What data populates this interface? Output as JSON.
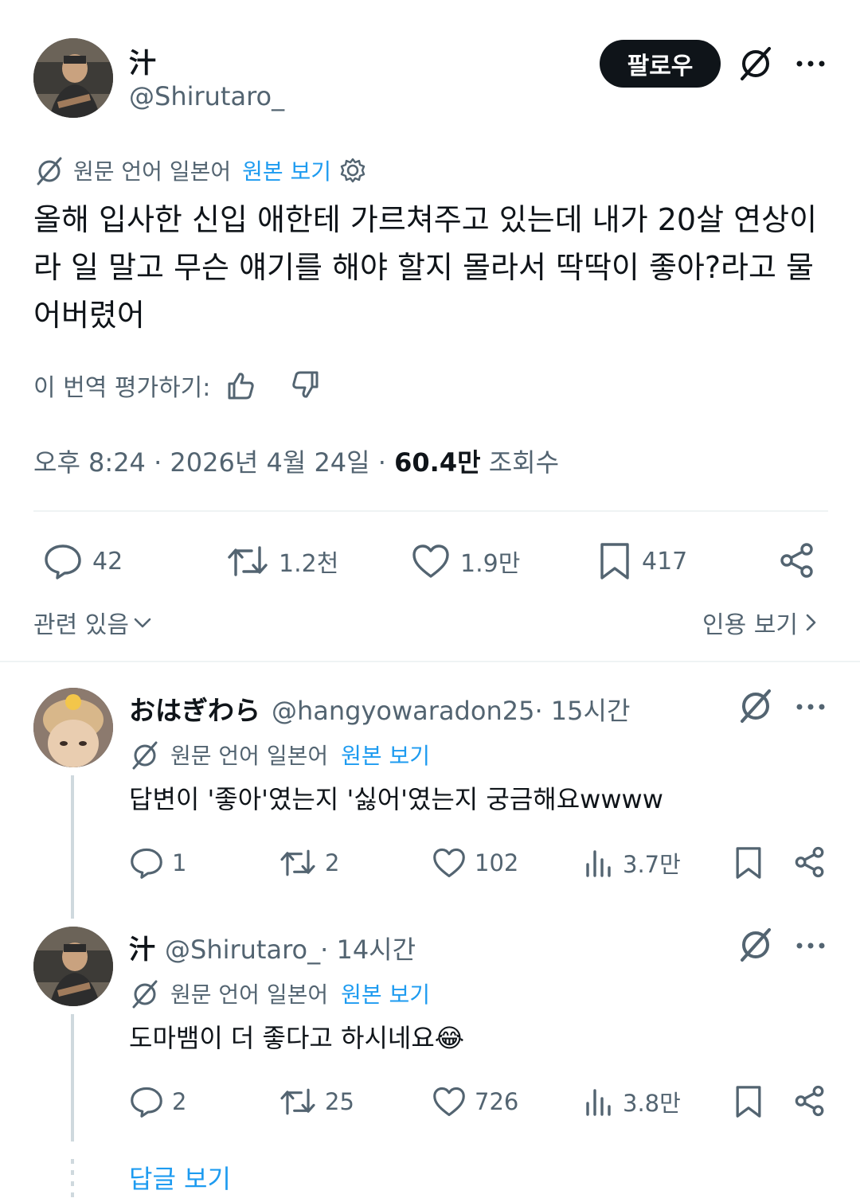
{
  "main_tweet": {
    "display_name": "汁",
    "handle": "@Shirutaro_",
    "follow_label": "팔로우",
    "translation_label": "원문 언어 일본어",
    "show_original": "원본 보기",
    "text": "올해 입사한 신입 애한테 가르쳐주고 있는데 내가 20살 연상이라 일 말고 무슨 얘기를 해야 할지 몰라서 딱딱이 좋아?라고 물어버렸어",
    "rate_translation": "이 번역 평가하기:",
    "timestamp": "오후 8:24 · 2026년 4월 24일 · ",
    "views_count": "60.4만",
    "views_label": " 조회수",
    "stats": {
      "replies": "42",
      "retweets": "1.2천",
      "likes": "1.9만",
      "bookmarks": "417"
    },
    "related_label": "관련 있음",
    "quotes_label": "인용 보기"
  },
  "replies": [
    {
      "display_name": "おはぎわら",
      "handle": "@hangyowaradon25",
      "time": " · 15시간",
      "translation_label": "원문 언어 일본어",
      "show_original": "원본 보기",
      "text": "답변이 '좋아'였는지 '싫어'였는지 궁금해요wwww",
      "stats": {
        "replies": "1",
        "retweets": "2",
        "likes": "102",
        "views": "3.7만"
      }
    },
    {
      "display_name": "汁",
      "handle": "@Shirutaro_",
      "time": " · 14시간",
      "translation_label": "원문 언어 일본어",
      "show_original": "원본 보기",
      "text": "도마뱀이 더 좋다고 하시네요😂",
      "stats": {
        "replies": "2",
        "retweets": "25",
        "likes": "726",
        "views": "3.8만"
      }
    }
  ],
  "show_replies_label": "답글 보기",
  "colors": {
    "accent": "#1d9bf0",
    "text": "#0f1419",
    "muted": "#536471"
  },
  "icons": [
    "translate-icon",
    "more-icon",
    "gear-icon",
    "thumbs-up-icon",
    "thumbs-down-icon",
    "reply-icon",
    "retweet-icon",
    "like-icon",
    "bookmark-icon",
    "share-icon",
    "views-icon",
    "chevron-down-icon",
    "chevron-right-icon"
  ]
}
